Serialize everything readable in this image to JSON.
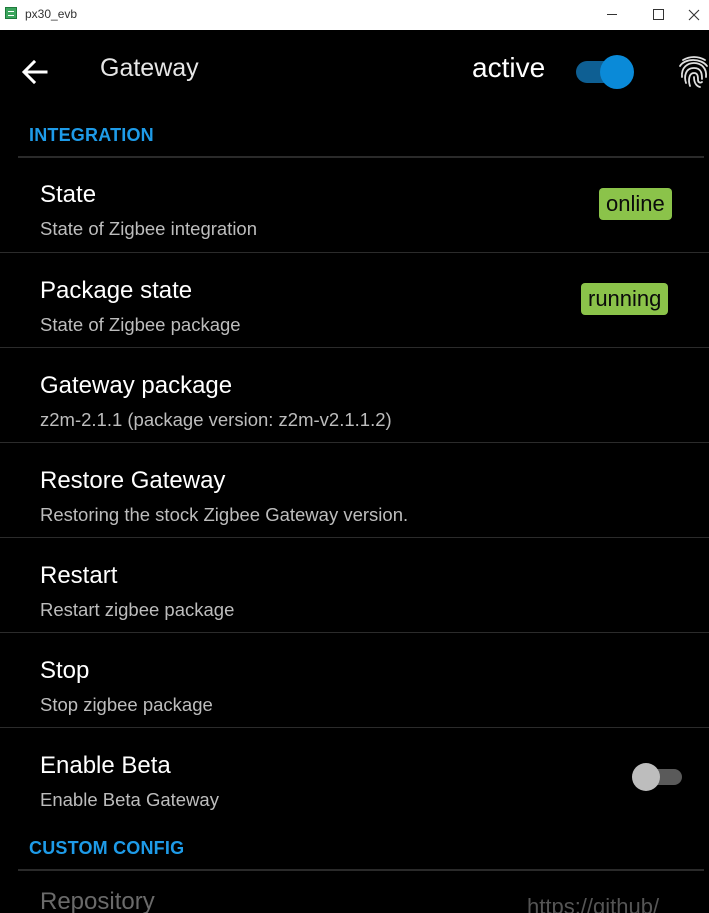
{
  "window": {
    "title": "px30_evb",
    "icon": "android-app-icon"
  },
  "header": {
    "back_icon": "arrow-left-icon",
    "title": "Gateway",
    "active_label": "active",
    "active_toggle_on": true,
    "fingerprint_icon": "fingerprint-icon"
  },
  "sections": {
    "integration": "INTEGRATION",
    "custom_config": "CUSTOM CONFIG"
  },
  "items": {
    "state": {
      "title": "State",
      "subtitle": "State of Zigbee integration",
      "badge": "online"
    },
    "package_state": {
      "title": "Package state",
      "subtitle": "State of Zigbee package",
      "badge": "running"
    },
    "gateway_package": {
      "title": "Gateway package",
      "subtitle": "z2m-2.1.1 (package version: z2m-v2.1.1.2)"
    },
    "restore_gateway": {
      "title": "Restore Gateway",
      "subtitle": "Restoring the stock Zigbee Gateway version."
    },
    "restart": {
      "title": "Restart",
      "subtitle": "Restart zigbee package"
    },
    "stop": {
      "title": "Stop",
      "subtitle": "Stop zigbee package"
    },
    "enable_beta": {
      "title": "Enable Beta",
      "subtitle": "Enable Beta Gateway",
      "toggle_on": false
    },
    "repository": {
      "title": "Repository",
      "value": "https://github/"
    }
  },
  "colors": {
    "accent": "#1e9be8",
    "badge": "#8bc34a",
    "toggle_active": "#0a8ad8",
    "background": "#000000"
  }
}
